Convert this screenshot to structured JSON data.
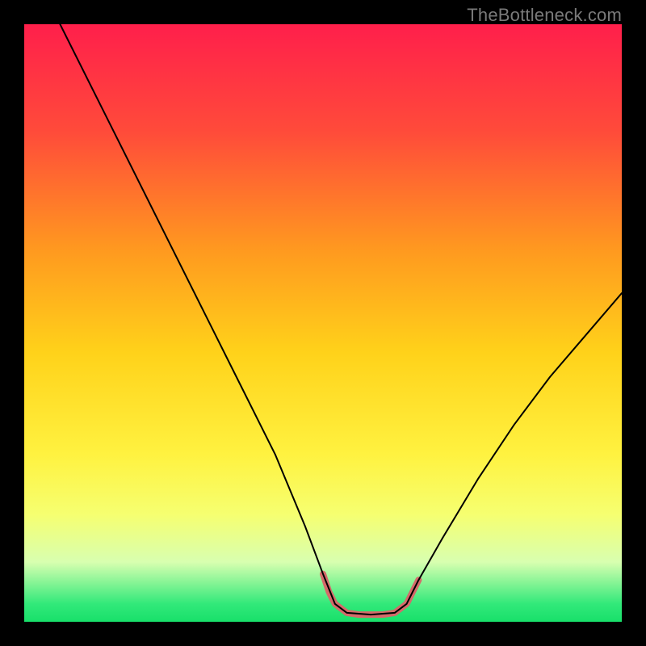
{
  "watermark": "TheBottleneck.com",
  "chart_data": {
    "type": "line",
    "title": "",
    "xlabel": "",
    "ylabel": "",
    "xlim": [
      0,
      100
    ],
    "ylim": [
      0,
      100
    ],
    "gradient_stops": [
      {
        "pct": 0,
        "color": "#ff1f4b"
      },
      {
        "pct": 18,
        "color": "#ff4b3a"
      },
      {
        "pct": 38,
        "color": "#ff9a1f"
      },
      {
        "pct": 55,
        "color": "#ffd21a"
      },
      {
        "pct": 72,
        "color": "#fff240"
      },
      {
        "pct": 82,
        "color": "#f6ff70"
      },
      {
        "pct": 90,
        "color": "#d8ffb0"
      },
      {
        "pct": 97,
        "color": "#32e97a"
      },
      {
        "pct": 100,
        "color": "#18e06a"
      }
    ],
    "series": [
      {
        "name": "bottleneck-curve",
        "color": "#000000",
        "stroke_width": 2,
        "points": [
          [
            6,
            100
          ],
          [
            12,
            88
          ],
          [
            18,
            76
          ],
          [
            24,
            64
          ],
          [
            30,
            52
          ],
          [
            36,
            40
          ],
          [
            42,
            28
          ],
          [
            47,
            16
          ],
          [
            50,
            8
          ],
          [
            52,
            3
          ],
          [
            54,
            1.5
          ],
          [
            58,
            1.2
          ],
          [
            62,
            1.5
          ],
          [
            64,
            3
          ],
          [
            66,
            7
          ],
          [
            70,
            14
          ],
          [
            76,
            24
          ],
          [
            82,
            33
          ],
          [
            88,
            41
          ],
          [
            94,
            48
          ],
          [
            100,
            55
          ]
        ]
      },
      {
        "name": "valley-highlight",
        "color": "#d46a6a",
        "stroke_width": 8,
        "points": [
          [
            50,
            8
          ],
          [
            51,
            5
          ],
          [
            52,
            3
          ],
          [
            54,
            1.5
          ],
          [
            56,
            1.2
          ],
          [
            58,
            1.2
          ],
          [
            60,
            1.2
          ],
          [
            62,
            1.5
          ],
          [
            64,
            3
          ],
          [
            65,
            5
          ],
          [
            66,
            7
          ]
        ]
      }
    ]
  }
}
